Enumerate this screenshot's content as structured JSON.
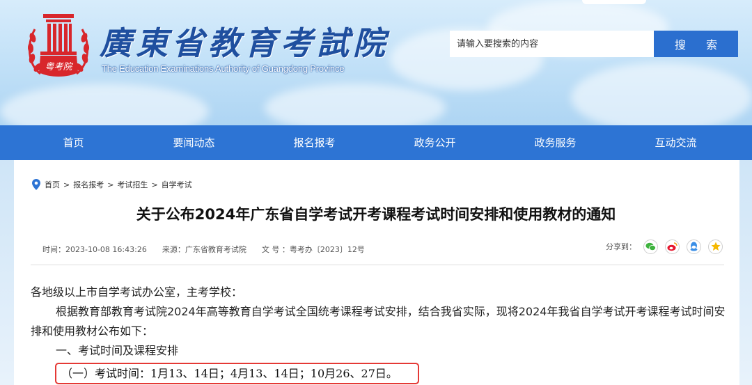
{
  "header": {
    "logo_text": "粤考院",
    "site_title": "廣東省教育考試院",
    "site_subtitle": "The Education Examinations Authority of Guangdong Province",
    "search_placeholder": "请输入要搜索的内容",
    "search_button": "搜 索"
  },
  "nav": {
    "items": [
      {
        "label": "首页"
      },
      {
        "label": "要闻动态"
      },
      {
        "label": "报名报考"
      },
      {
        "label": "政务公开"
      },
      {
        "label": "政务服务"
      },
      {
        "label": "互动交流"
      }
    ]
  },
  "breadcrumb": {
    "items": [
      "首页",
      "报名报考",
      "考试招生",
      "自学考试"
    ],
    "separator": ">"
  },
  "article": {
    "title": "关于公布2024年广东省自学考试开考课程考试时间安排和使用教材的通知",
    "meta": {
      "time": "时间：2023-10-08 16:43:26",
      "source": "来源：广东省教育考试院",
      "doc_no": "文 号 ：粤考办〔2023〕12号"
    },
    "share_label": "分享到：",
    "share_icons": [
      "wechat-icon",
      "weibo-icon",
      "qq-icon",
      "qzone-icon"
    ],
    "paragraphs": [
      "各地级以上市自学考试办公室，主考学校：",
      "根据教育部教育考试院2024年高等教育自学考试全国统考课程考试安排，结合我省实际，现将2024年我省自学考试开考课程考试时间安排和使用教材公布如下：",
      "一、考试时间及课程安排",
      "（一）考试时间：1月13、14日；4月13、14日；10月26、27日。"
    ]
  },
  "colors": {
    "nav_bg": "#2d74d4",
    "search_button_bg": "#2b6fcf",
    "title_blue": "#1f4f9f",
    "logo_red": "#d8262b",
    "highlight_border": "#e53935"
  }
}
